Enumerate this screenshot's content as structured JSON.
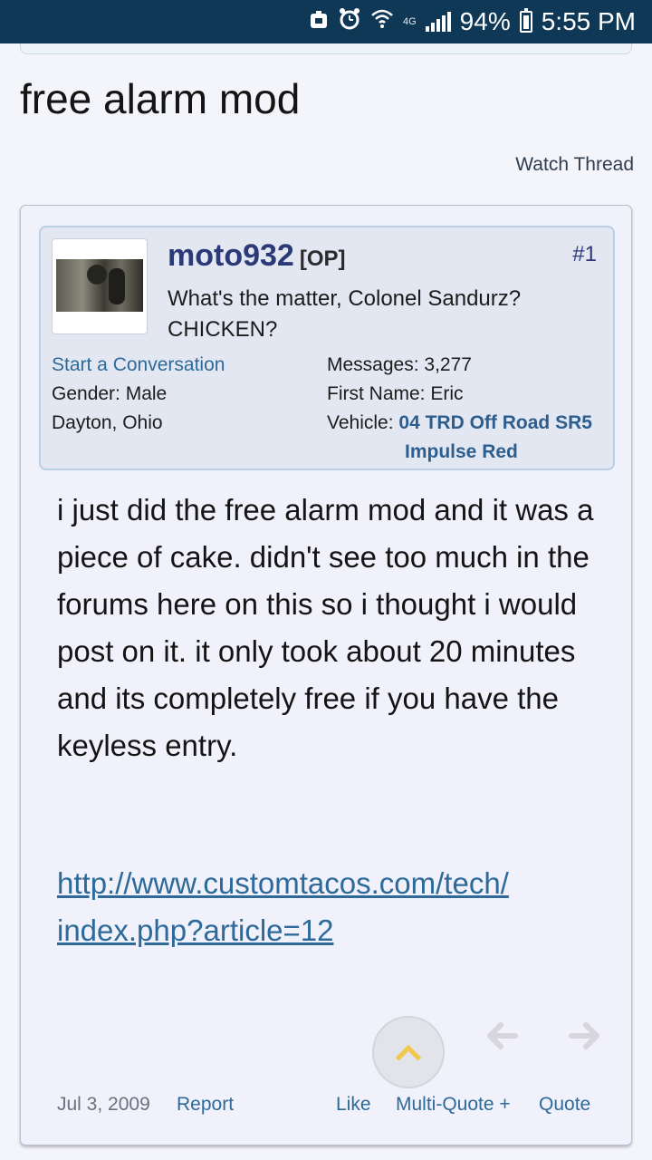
{
  "status_bar": {
    "network": "4G",
    "battery": "94%",
    "time": "5:55 PM"
  },
  "thread": {
    "title": "free alarm mod",
    "watch_label": "Watch Thread"
  },
  "post": {
    "username": "moto932",
    "op_tag": "[OP]",
    "post_number": "#1",
    "user_title": "What's the matter, Colonel Sandurz? CHICKEN?",
    "start_conversation": "Start a Conversation",
    "gender": "Gender: Male",
    "location": "Dayton, Ohio",
    "messages_label": "Messages:",
    "messages_value": "3,277",
    "first_name_label": "First Name:",
    "first_name_value": "Eric",
    "vehicle_label": "Vehicle:",
    "vehicle_line1": "04 TRD Off Road SR5",
    "vehicle_line2": "Impulse Red",
    "body": "i just did the free alarm mod and it was a piece of cake. didn't see too much in the forums here on this so i thought i would post on it. it only took about 20 minutes and its completely free if you have the keyless entry.",
    "link_line1": "http://www.customtacos.com/tech/",
    "link_line2": "index.php?article=12",
    "date": "Jul 3, 2009",
    "report": "Report",
    "like": "Like",
    "multiquote": "Multi-Quote +",
    "quote": "Quote"
  },
  "icons": {
    "scroll_top": "chevron-up-icon",
    "prev": "arrow-left-icon",
    "next": "arrow-right-icon"
  },
  "colors": {
    "status_bar": "#0f3856",
    "link": "#2d6a9a",
    "username": "#2b3a76",
    "scroll_chevron": "#f2c84b"
  }
}
